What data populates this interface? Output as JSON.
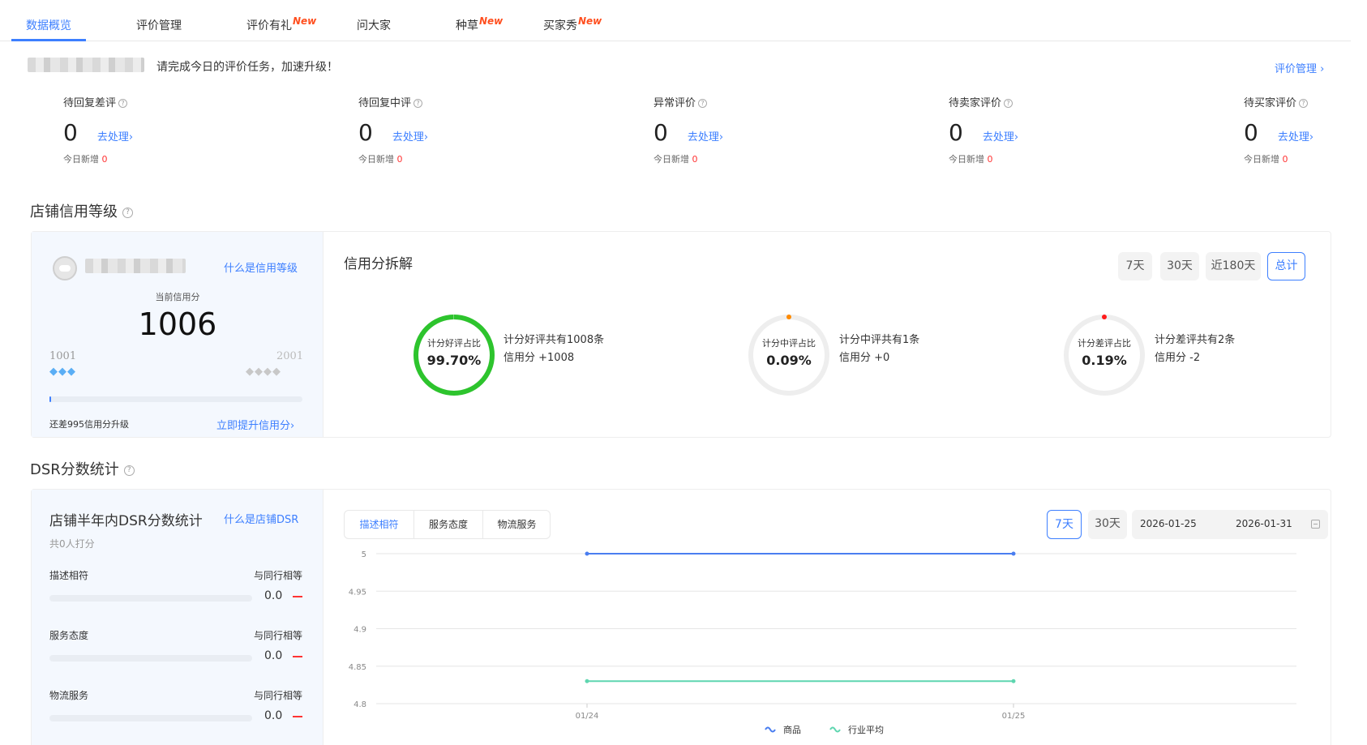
{
  "tabs": [
    {
      "label": "数据概览",
      "new": ""
    },
    {
      "label": "评价管理",
      "new": ""
    },
    {
      "label": "评价有礼",
      "new": "New"
    },
    {
      "label": "问大家",
      "new": ""
    },
    {
      "label": "种草",
      "new": "New"
    },
    {
      "label": "买家秀",
      "new": "New"
    }
  ],
  "banner": {
    "text": "请完成今日的评价任务，加速升级！",
    "manage_link": "评价管理 ›"
  },
  "stats": [
    {
      "label": "待回复差评",
      "value": "0",
      "link": "去处理›",
      "today_label": "今日新增",
      "today_value": "0"
    },
    {
      "label": "待回复中评",
      "value": "0",
      "link": "去处理›",
      "today_label": "今日新增",
      "today_value": "0"
    },
    {
      "label": "异常评价",
      "value": "0",
      "link": "去处理›",
      "today_label": "今日新增",
      "today_value": "0"
    },
    {
      "label": "待卖家评价",
      "value": "0",
      "link": "去处理›",
      "today_label": "今日新增",
      "today_value": "0"
    },
    {
      "label": "待买家评价",
      "value": "0",
      "link": "去处理›",
      "today_label": "今日新增",
      "today_value": "0"
    }
  ],
  "credit": {
    "section_title": "店铺信用等级",
    "what_is_link": "什么是信用等级",
    "current_label": "当前信用分",
    "score": "1006",
    "min_label": "1001",
    "max_label": "2001",
    "progress_fraction": 0.006,
    "remaining_text": "还差995信用分升级",
    "improve_link": "立即提升信用分›",
    "breakdown_title": "信用分拆解",
    "ranges": [
      "7天",
      "30天",
      "近180天",
      "总计"
    ],
    "active_range": "总计",
    "rings": [
      {
        "label": "计分好评占比",
        "value": "99.70%",
        "fraction": 0.997,
        "color": "#2dc42d",
        "line1": "计分好评共有1008条",
        "line2": "信用分 +1008"
      },
      {
        "label": "计分中评占比",
        "value": "0.09%",
        "fraction": 0.0009,
        "color": "#ff8a00",
        "line1": "计分中评共有1条",
        "line2": "信用分 +0"
      },
      {
        "label": "计分差评占比",
        "value": "0.19%",
        "fraction": 0.0019,
        "color": "#ff1a1a",
        "line1": "计分差评共有2条",
        "line2": "信用分 -2"
      }
    ]
  },
  "dsr": {
    "section_title": "DSR分数统计",
    "panel_title": "店铺半年内DSR分数统计",
    "what_is_link": "什么是店铺DSR",
    "raters": "共0人打分",
    "rows": [
      {
        "label": "描述相符",
        "compare": "与同行相等",
        "value": "0.0"
      },
      {
        "label": "服务态度",
        "compare": "与同行相等",
        "value": "0.0"
      },
      {
        "label": "物流服务",
        "compare": "与同行相等",
        "value": "0.0"
      }
    ],
    "segments": [
      "描述相符",
      "服务态度",
      "物流服务"
    ],
    "active_segment": "描述相符",
    "ranges": [
      "7天",
      "30天"
    ],
    "active_range": "7天",
    "date_start": "2026-01-25",
    "date_end": "2026-01-31"
  },
  "chart_data": {
    "type": "line",
    "x": [
      "01/24",
      "01/25"
    ],
    "yticks": [
      "5",
      "4.95",
      "4.9",
      "4.85",
      "4.8"
    ],
    "ylim": [
      4.8,
      5
    ],
    "series": [
      {
        "name": "商品",
        "values": [
          5,
          5
        ],
        "color": "#4a7ef0"
      },
      {
        "name": "行业平均",
        "values": [
          4.83,
          4.83
        ],
        "color": "#5fd6b0"
      }
    ]
  }
}
